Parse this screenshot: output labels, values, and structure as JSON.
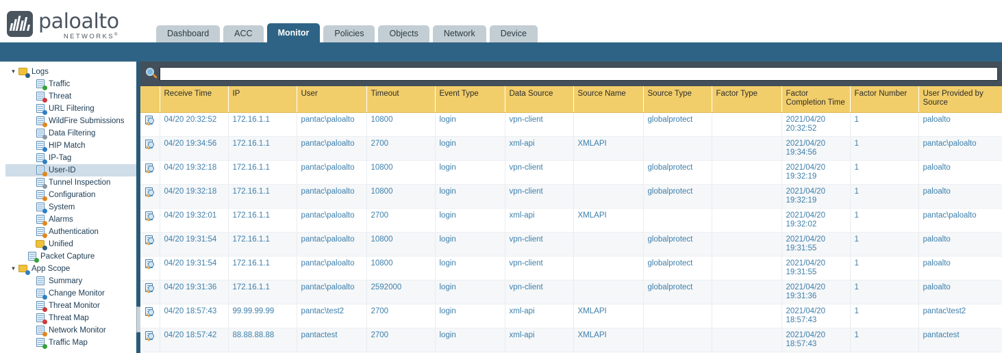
{
  "brand": {
    "name": "paloalto",
    "tagline": "NETWORKS",
    "trademark": "®"
  },
  "nav": {
    "tabs": [
      {
        "label": "Dashboard",
        "active": false
      },
      {
        "label": "ACC",
        "active": false
      },
      {
        "label": "Monitor",
        "active": true
      },
      {
        "label": "Policies",
        "active": false
      },
      {
        "label": "Objects",
        "active": false
      },
      {
        "label": "Network",
        "active": false
      },
      {
        "label": "Device",
        "active": false
      }
    ]
  },
  "sidebar": {
    "items": [
      {
        "label": "Logs",
        "level": 0,
        "twisty": "▼",
        "icon": "folder-docs-icon",
        "iconType": "folder",
        "badge": "dark",
        "selected": false
      },
      {
        "label": "Traffic",
        "level": 1,
        "twisty": "",
        "icon": "traffic-log-icon",
        "iconType": "doc",
        "badge": "green",
        "selected": false
      },
      {
        "label": "Threat",
        "level": 1,
        "twisty": "",
        "icon": "threat-log-icon",
        "iconType": "doc",
        "badge": "red",
        "selected": false
      },
      {
        "label": "URL Filtering",
        "level": 1,
        "twisty": "",
        "icon": "url-filtering-log-icon",
        "iconType": "doc",
        "badge": "blue",
        "selected": false
      },
      {
        "label": "WildFire Submissions",
        "level": 1,
        "twisty": "",
        "icon": "wildfire-log-icon",
        "iconType": "doc",
        "badge": "orange",
        "selected": false
      },
      {
        "label": "Data Filtering",
        "level": 1,
        "twisty": "",
        "icon": "data-filtering-log-icon",
        "iconType": "doc",
        "badge": "gray",
        "selected": false
      },
      {
        "label": "HIP Match",
        "level": 1,
        "twisty": "",
        "icon": "hip-match-log-icon",
        "iconType": "doc",
        "badge": "blue",
        "selected": false
      },
      {
        "label": "IP-Tag",
        "level": 1,
        "twisty": "",
        "icon": "ip-tag-log-icon",
        "iconType": "doc",
        "badge": "blue",
        "selected": false
      },
      {
        "label": "User-ID",
        "level": 1,
        "twisty": "",
        "icon": "user-id-log-icon",
        "iconType": "doc",
        "badge": "orange",
        "selected": true
      },
      {
        "label": "Tunnel Inspection",
        "level": 1,
        "twisty": "",
        "icon": "tunnel-inspection-log-icon",
        "iconType": "doc",
        "badge": "gray",
        "selected": false
      },
      {
        "label": "Configuration",
        "level": 1,
        "twisty": "",
        "icon": "configuration-log-icon",
        "iconType": "doc",
        "badge": "orange",
        "selected": false
      },
      {
        "label": "System",
        "level": 1,
        "twisty": "",
        "icon": "system-log-icon",
        "iconType": "doc",
        "badge": "blue",
        "selected": false
      },
      {
        "label": "Alarms",
        "level": 1,
        "twisty": "",
        "icon": "alarms-log-icon",
        "iconType": "doc",
        "badge": "orange",
        "selected": false
      },
      {
        "label": "Authentication",
        "level": 1,
        "twisty": "",
        "icon": "authentication-log-icon",
        "iconType": "doc",
        "badge": "orange",
        "selected": false
      },
      {
        "label": "Unified",
        "level": 1,
        "twisty": "",
        "icon": "unified-log-icon",
        "iconType": "folder",
        "badge": "dark",
        "selected": false
      },
      {
        "label": "Packet Capture",
        "level": 2,
        "twisty": "",
        "icon": "packet-capture-icon",
        "iconType": "probe",
        "badge": "green",
        "selected": false
      },
      {
        "label": "App Scope",
        "level": 0,
        "twisty": "▼",
        "icon": "app-scope-folder-icon",
        "iconType": "folder",
        "badge": "blue",
        "selected": false
      },
      {
        "label": "Summary",
        "level": 1,
        "twisty": "",
        "icon": "summary-icon",
        "iconType": "grid",
        "badge": "",
        "selected": false
      },
      {
        "label": "Change Monitor",
        "level": 1,
        "twisty": "",
        "icon": "change-monitor-icon",
        "iconType": "doc",
        "badge": "blue",
        "selected": false
      },
      {
        "label": "Threat Monitor",
        "level": 1,
        "twisty": "",
        "icon": "threat-monitor-icon",
        "iconType": "chart",
        "badge": "red",
        "selected": false
      },
      {
        "label": "Threat Map",
        "level": 1,
        "twisty": "",
        "icon": "threat-map-icon",
        "iconType": "globe",
        "badge": "red",
        "selected": false
      },
      {
        "label": "Network Monitor",
        "level": 1,
        "twisty": "",
        "icon": "network-monitor-icon",
        "iconType": "area",
        "badge": "orange",
        "selected": false
      },
      {
        "label": "Traffic Map",
        "level": 1,
        "twisty": "",
        "icon": "traffic-map-icon",
        "iconType": "globe",
        "badge": "green",
        "selected": false
      }
    ]
  },
  "search": {
    "icon": "search-icon",
    "value": "",
    "placeholder": ""
  },
  "table": {
    "columns": [
      {
        "key": "detail",
        "label": "",
        "width": 28
      },
      {
        "key": "receive_time",
        "label": "Receive Time",
        "width": 100
      },
      {
        "key": "ip",
        "label": "IP",
        "width": 100
      },
      {
        "key": "user",
        "label": "User",
        "width": 102
      },
      {
        "key": "timeout",
        "label": "Timeout",
        "width": 100
      },
      {
        "key": "event_type",
        "label": "Event Type",
        "width": 102
      },
      {
        "key": "data_source",
        "label": "Data Source",
        "width": 100
      },
      {
        "key": "source_name",
        "label": "Source Name",
        "width": 102
      },
      {
        "key": "source_type",
        "label": "Source Type",
        "width": 100
      },
      {
        "key": "factor_type",
        "label": "Factor Type",
        "width": 102
      },
      {
        "key": "factor_completion_time",
        "label": "Factor Completion Time",
        "width": 100
      },
      {
        "key": "factor_number",
        "label": "Factor Number",
        "width": 100
      },
      {
        "key": "user_provided_by_source",
        "label": "User Provided by Source",
        "width": 122
      }
    ],
    "row_icon": "log-detail-icon",
    "rows": [
      {
        "receive_time": "04/20 20:32:52",
        "ip": "172.16.1.1",
        "user": "pantac\\paloalto",
        "timeout": "10800",
        "event_type": "login",
        "data_source": "vpn-client",
        "source_name": "",
        "source_type": "globalprotect",
        "factor_type": "",
        "factor_completion_time": "2021/04/20\n20:32:52",
        "factor_number": "1",
        "user_provided_by_source": "paloalto"
      },
      {
        "receive_time": "04/20 19:34:56",
        "ip": "172.16.1.1",
        "user": "pantac\\paloalto",
        "timeout": "2700",
        "event_type": "login",
        "data_source": "xml-api",
        "source_name": "XMLAPI",
        "source_type": "",
        "factor_type": "",
        "factor_completion_time": "2021/04/20\n19:34:56",
        "factor_number": "1",
        "user_provided_by_source": "pantac\\paloalto"
      },
      {
        "receive_time": "04/20 19:32:18",
        "ip": "172.16.1.1",
        "user": "pantac\\paloalto",
        "timeout": "10800",
        "event_type": "login",
        "data_source": "vpn-client",
        "source_name": "",
        "source_type": "globalprotect",
        "factor_type": "",
        "factor_completion_time": "2021/04/20\n19:32:19",
        "factor_number": "1",
        "user_provided_by_source": "paloalto"
      },
      {
        "receive_time": "04/20 19:32:18",
        "ip": "172.16.1.1",
        "user": "pantac\\paloalto",
        "timeout": "10800",
        "event_type": "login",
        "data_source": "vpn-client",
        "source_name": "",
        "source_type": "globalprotect",
        "factor_type": "",
        "factor_completion_time": "2021/04/20\n19:32:19",
        "factor_number": "1",
        "user_provided_by_source": "paloalto"
      },
      {
        "receive_time": "04/20 19:32:01",
        "ip": "172.16.1.1",
        "user": "pantac\\paloalto",
        "timeout": "2700",
        "event_type": "login",
        "data_source": "xml-api",
        "source_name": "XMLAPI",
        "source_type": "",
        "factor_type": "",
        "factor_completion_time": "2021/04/20\n19:32:02",
        "factor_number": "1",
        "user_provided_by_source": "pantac\\paloalto"
      },
      {
        "receive_time": "04/20 19:31:54",
        "ip": "172.16.1.1",
        "user": "pantac\\paloalto",
        "timeout": "10800",
        "event_type": "login",
        "data_source": "vpn-client",
        "source_name": "",
        "source_type": "globalprotect",
        "factor_type": "",
        "factor_completion_time": "2021/04/20\n19:31:55",
        "factor_number": "1",
        "user_provided_by_source": "paloalto"
      },
      {
        "receive_time": "04/20 19:31:54",
        "ip": "172.16.1.1",
        "user": "pantac\\paloalto",
        "timeout": "10800",
        "event_type": "login",
        "data_source": "vpn-client",
        "source_name": "",
        "source_type": "globalprotect",
        "factor_type": "",
        "factor_completion_time": "2021/04/20\n19:31:55",
        "factor_number": "1",
        "user_provided_by_source": "paloalto"
      },
      {
        "receive_time": "04/20 19:31:36",
        "ip": "172.16.1.1",
        "user": "pantac\\paloalto",
        "timeout": "2592000",
        "event_type": "login",
        "data_source": "vpn-client",
        "source_name": "",
        "source_type": "globalprotect",
        "factor_type": "",
        "factor_completion_time": "2021/04/20\n19:31:36",
        "factor_number": "1",
        "user_provided_by_source": "paloalto"
      },
      {
        "receive_time": "04/20 18:57:43",
        "ip": "99.99.99.99",
        "user": "pantac\\test2",
        "timeout": "2700",
        "event_type": "login",
        "data_source": "xml-api",
        "source_name": "XMLAPI",
        "source_type": "",
        "factor_type": "",
        "factor_completion_time": "2021/04/20\n18:57:43",
        "factor_number": "1",
        "user_provided_by_source": "pantac\\test2"
      },
      {
        "receive_time": "04/20 18:57:42",
        "ip": "88.88.88.88",
        "user": "pantactest",
        "timeout": "2700",
        "event_type": "login",
        "data_source": "xml-api",
        "source_name": "XMLAPI",
        "source_type": "",
        "factor_type": "",
        "factor_completion_time": "2021/04/20\n18:57:43",
        "factor_number": "1",
        "user_provided_by_source": "pantactest"
      }
    ]
  },
  "colors": {
    "brand_blue": "#2e6385",
    "header_yellow": "#f2ce6a",
    "toolbar_dark": "#434f5a",
    "link_blue": "#3d7faa",
    "tab_inactive": "#c3ced4"
  }
}
